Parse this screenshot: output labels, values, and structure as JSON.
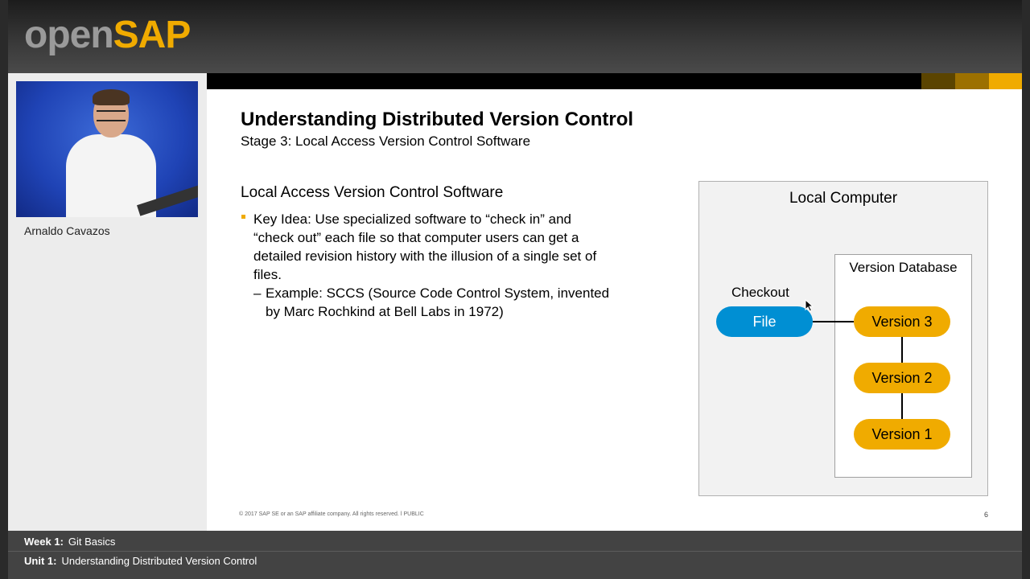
{
  "brand": {
    "open": "open",
    "sap": "SAP"
  },
  "presenter": {
    "name": "Arnaldo Cavazos"
  },
  "slide": {
    "title": "Understanding Distributed Version Control",
    "subtitle": "Stage 3: Local Access Version Control Software",
    "section_heading": "Local Access Version Control Software",
    "bullet": "Key Idea: Use specialized software to “check in” and “check out” each file so that computer users can get a detailed revision history with the illusion of a single set of files.",
    "subbullet_dash": "–",
    "subbullet": "Example: SCCS (Source Code Control System, invented by Marc Rochkind at Bell Labs in 1972)",
    "footer": "© 2017 SAP SE or an SAP affiliate company. All rights reserved.  ǀ  PUBLIC",
    "page_number": "6"
  },
  "diagram": {
    "title": "Local Computer",
    "database_title": "Version Database",
    "checkout_label": "Checkout",
    "file_label": "File",
    "versions": [
      "Version 3",
      "Version 2",
      "Version 1"
    ]
  },
  "course": {
    "week_label": "Week 1:",
    "week_value": "Git Basics",
    "unit_label": "Unit 1:",
    "unit_value": "Understanding Distributed Version Control"
  },
  "colors": {
    "sap_gold": "#f0ab00",
    "file_blue": "#008fd3",
    "header_stripes": [
      "#5b4400",
      "#9c7000",
      "#f0ab00"
    ]
  }
}
